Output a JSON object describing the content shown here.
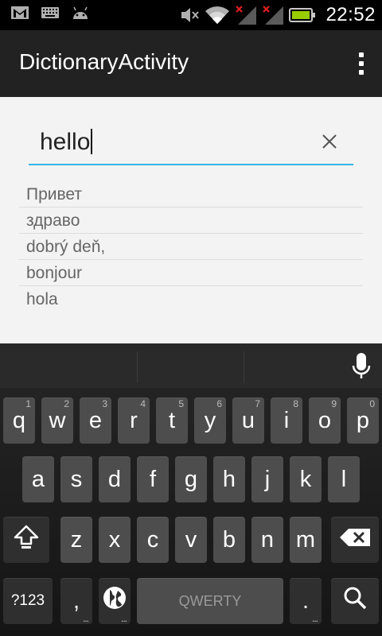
{
  "status_bar": {
    "clock": "22:52",
    "icons": [
      "gmail-icon",
      "keyboard-icon",
      "android-icon",
      "mute-icon",
      "wifi-icon",
      "signal-icon",
      "signal-icon",
      "battery-icon"
    ]
  },
  "action_bar": {
    "title": "DictionaryActivity",
    "overflow_icon": "overflow-menu-icon"
  },
  "search": {
    "value": "hello",
    "clear_icon": "close-icon"
  },
  "results": [
    {
      "text": "Привет"
    },
    {
      "text": "здраво"
    },
    {
      "text": "dobrý deň,"
    },
    {
      "text": "bonjour"
    },
    {
      "text": "hola"
    }
  ],
  "keyboard": {
    "row1": [
      {
        "label": "q",
        "hint": "1"
      },
      {
        "label": "w",
        "hint": "2"
      },
      {
        "label": "e",
        "hint": "3"
      },
      {
        "label": "r",
        "hint": "4"
      },
      {
        "label": "t",
        "hint": "5"
      },
      {
        "label": "y",
        "hint": "6"
      },
      {
        "label": "u",
        "hint": "7"
      },
      {
        "label": "i",
        "hint": "8"
      },
      {
        "label": "o",
        "hint": "9"
      },
      {
        "label": "p",
        "hint": "0"
      }
    ],
    "row2": [
      "a",
      "s",
      "d",
      "f",
      "g",
      "h",
      "j",
      "k",
      "l"
    ],
    "row3": [
      "z",
      "x",
      "c",
      "v",
      "b",
      "n",
      "m"
    ],
    "symbols_label": "?123",
    "comma_label": ",",
    "space_label": "QWERTY",
    "period_label": ".",
    "dots": "...",
    "accent_color": "#33b5e5"
  }
}
